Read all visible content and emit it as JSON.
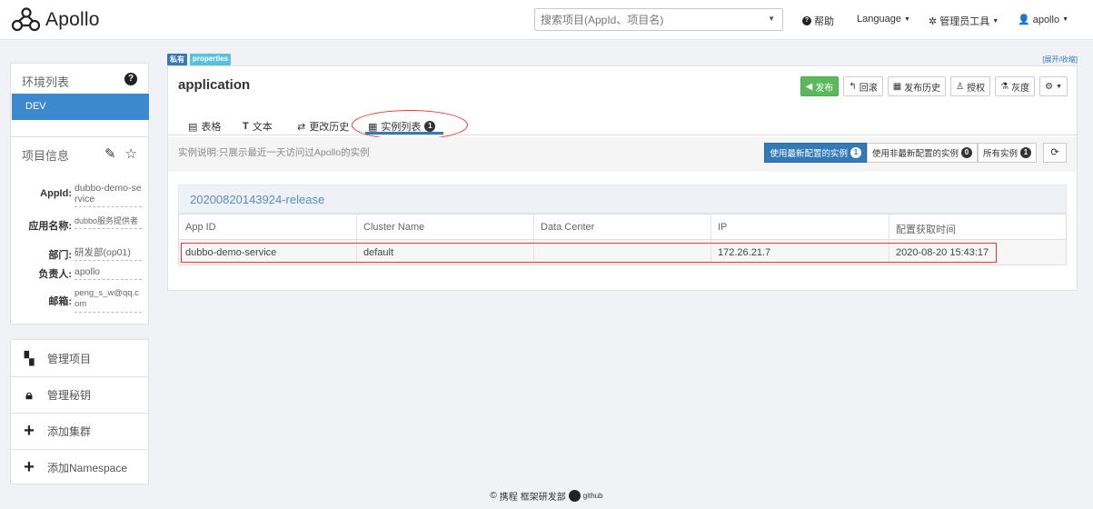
{
  "navbar": {
    "logo_text": "Apollo",
    "search_placeholder": "搜索项目(AppId、项目名)",
    "help": "帮助",
    "language": "Language",
    "admin_tools": "管理员工具",
    "user": "apollo"
  },
  "env_panel": {
    "title": "环境列表",
    "active_env": "DEV"
  },
  "project_info": {
    "title": "项目信息",
    "rows": [
      {
        "key": "AppId:",
        "value": "dubbo-demo-service"
      },
      {
        "key": "应用名称:",
        "value": "dubbo服务提供者"
      },
      {
        "key": "部门:",
        "value": "研发部(op01)"
      },
      {
        "key": "负责人:",
        "value": "apollo"
      },
      {
        "key": "邮箱:",
        "value": "peng_s_w@qq.com"
      }
    ]
  },
  "menu": {
    "items": [
      {
        "label": "管理项目",
        "icon": "grid-star-icon"
      },
      {
        "label": "管理秘钥",
        "icon": "lock-icon"
      },
      {
        "label": "添加集群",
        "icon": "plus-icon"
      },
      {
        "label": "添加Namespace",
        "icon": "plus-icon"
      }
    ]
  },
  "namespace": {
    "badge_private": "私有",
    "badge_format": "properties",
    "expand_link": "[展开/收缩]",
    "title": "application",
    "actions": {
      "publish": "发布",
      "rollback": "回滚",
      "history": "发布历史",
      "authorize": "授权",
      "gray": "灰度"
    },
    "tabs": {
      "table": "表格",
      "text": "文本",
      "change_history": "更改历史",
      "instances": "实例列表",
      "instances_count": "1"
    },
    "toolbar": {
      "description": "实例说明:只展示最近一天访问过Apollo的实例",
      "latest": "使用最新配置的实例",
      "latest_count": "1",
      "non_latest": "使用非最新配置的实例",
      "non_latest_count": "0",
      "all": "所有实例",
      "all_count": "1"
    },
    "release_name": "20200820143924-release",
    "table": {
      "headers": [
        "App ID",
        "Cluster Name",
        "Data Center",
        "IP",
        "配置获取时间"
      ],
      "rows": [
        [
          "dubbo-demo-service",
          "default",
          "",
          "172.26.21.7",
          "2020-08-20 15:43:17"
        ]
      ]
    }
  },
  "footer": {
    "company": "携程",
    "dept": "框架研发部",
    "github": "github"
  }
}
